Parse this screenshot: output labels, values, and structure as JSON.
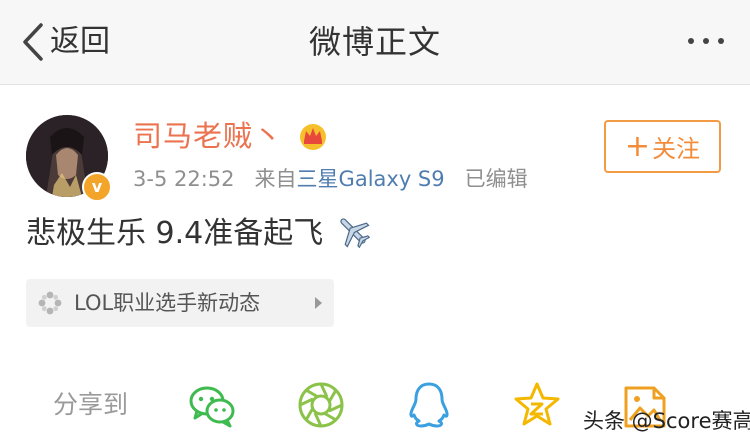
{
  "nav": {
    "back_label": "返回",
    "title": "微博正文"
  },
  "post": {
    "author": "司马老贼丶",
    "verified_badge": "v",
    "time": "3-5 22:52",
    "source_prefix": "来自",
    "source": "三星Galaxy S9",
    "edited": "已编辑",
    "follow_label": "关注",
    "follow_plus": "+",
    "text": "悲极生乐 9.4准备起飞",
    "emoji": "airplane",
    "topic": "LOL职业选手新动态"
  },
  "share": {
    "label": "分享到",
    "targets": [
      "wechat-icon",
      "moments-icon",
      "qq-icon",
      "qzone-icon",
      "picture-icon"
    ]
  },
  "watermark": "头条 @Score赛高",
  "colors": {
    "accent_orange": "#eb7350",
    "follow_orange": "#f28c3a",
    "link_blue": "#507daf",
    "wechat_green": "#3fba4f",
    "qq_blue": "#3aa0e0",
    "qzone_yellow": "#f5b800"
  }
}
